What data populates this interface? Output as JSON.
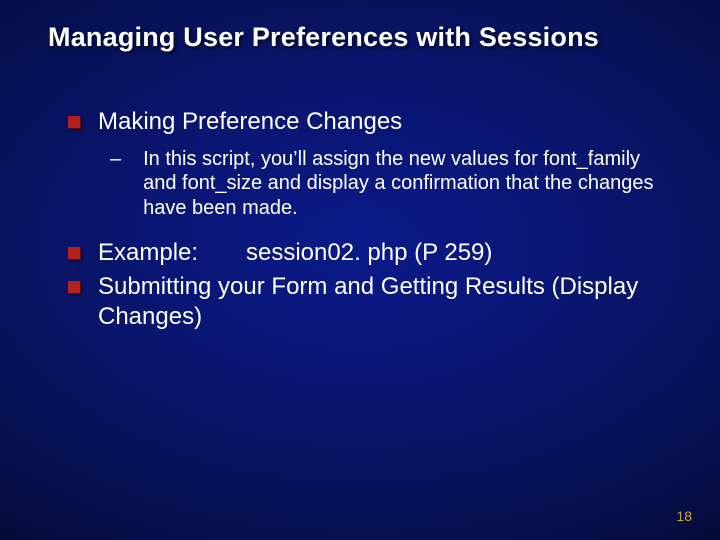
{
  "title": "Managing User Preferences with Sessions",
  "bullets": {
    "b1": "Making Preference Changes",
    "b1_sub": "In this script, you’ll assign the new values for font_family and font_size and display a confirmation that the changes have been made.",
    "b2_label": "Example:",
    "b2_rest": "session02. php (P 259)",
    "b3": "Submitting your Form and Getting Results (Display Changes)"
  },
  "page_number": "18"
}
